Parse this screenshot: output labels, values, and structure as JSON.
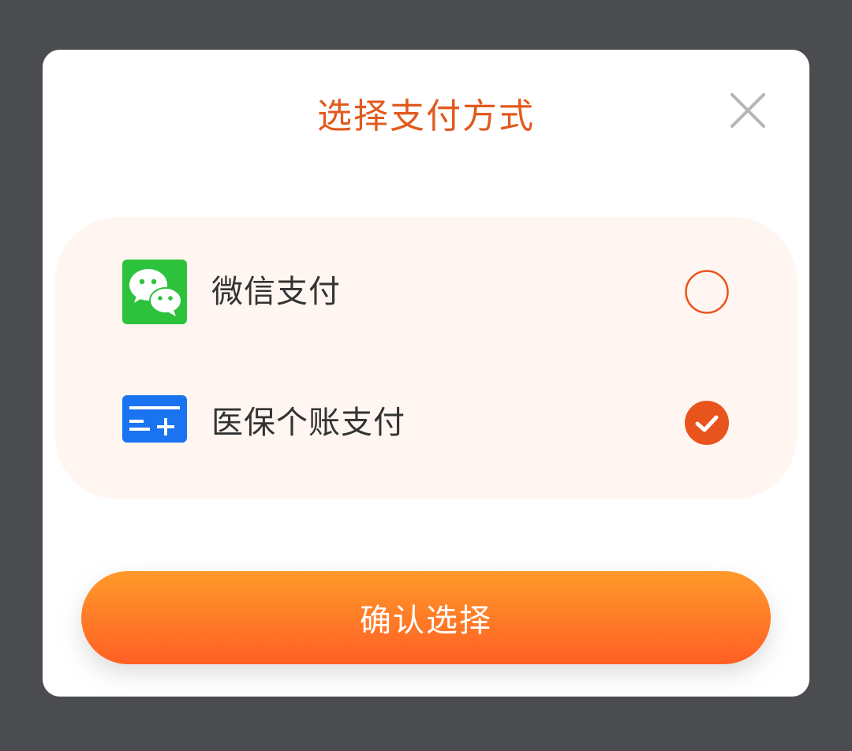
{
  "dialog": {
    "title": "选择支付方式",
    "close_icon": "close-icon",
    "confirm_label": "确认选择"
  },
  "options": [
    {
      "label": "微信支付",
      "icon": "wechat-pay-icon",
      "selected": false
    },
    {
      "label": "医保个账支付",
      "icon": "medical-insurance-card-icon",
      "selected": true
    }
  ],
  "colors": {
    "overlay": "#4b4c50",
    "accent": "#e8541c",
    "title": "#e15a1e",
    "options_bg": "#fff6f1",
    "wechat_green": "#2dc23c",
    "card_blue": "#1a73f0",
    "close_gray": "#b5b5b5",
    "button_top": "#ff9a2a",
    "button_bottom": "#ff5f24"
  }
}
